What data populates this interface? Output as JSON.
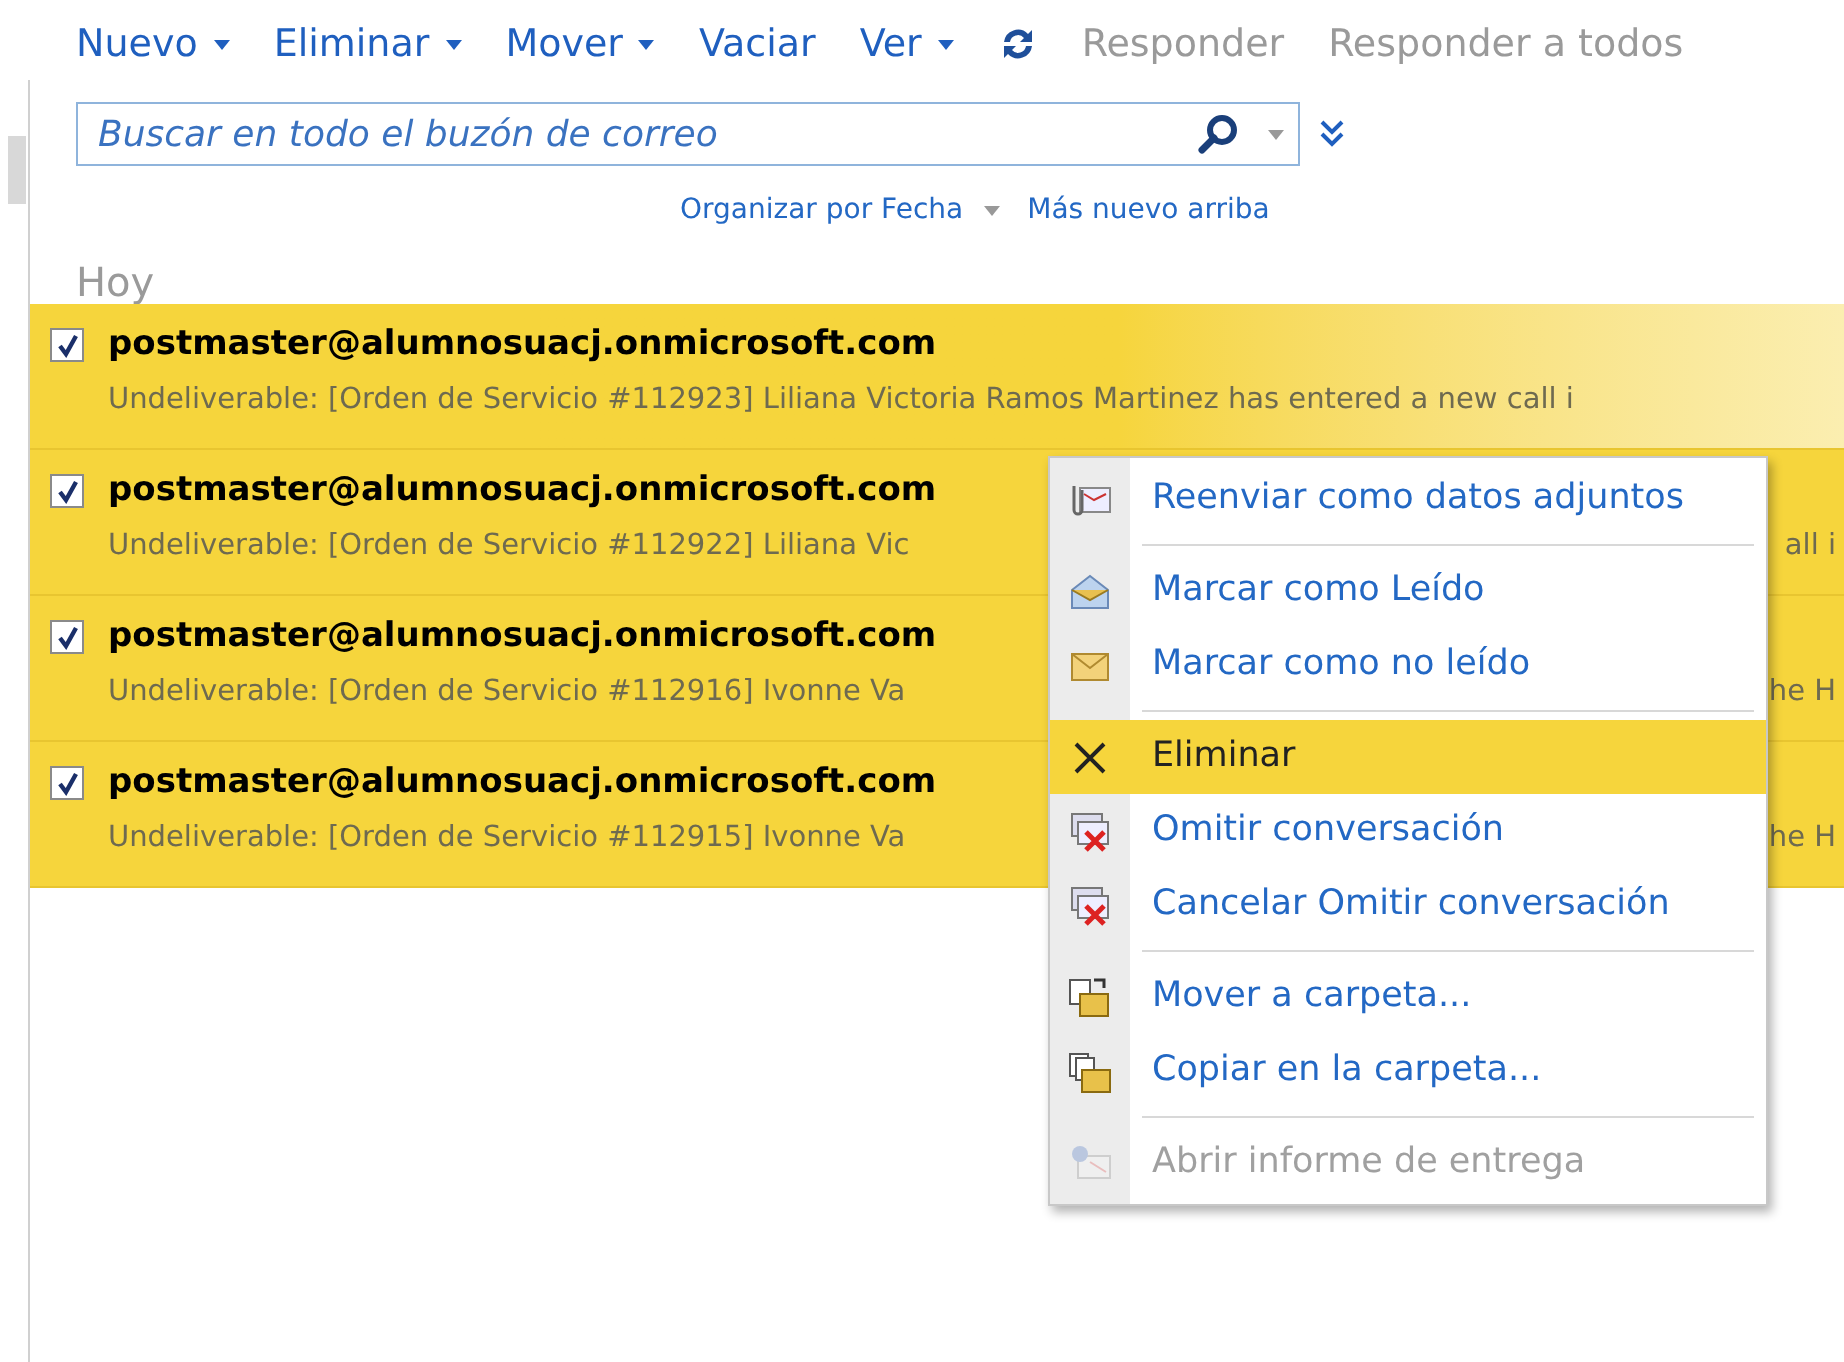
{
  "toolbar": [
    {
      "label": "Nuevo",
      "kind": "dropdown",
      "disabled": false
    },
    {
      "label": "Eliminar",
      "kind": "dropdown",
      "disabled": false
    },
    {
      "label": "Mover",
      "kind": "dropdown",
      "disabled": false
    },
    {
      "label": "Vaciar",
      "kind": "plain",
      "disabled": false
    },
    {
      "label": "Ver",
      "kind": "dropdown",
      "disabled": false
    },
    {
      "kind": "refresh"
    },
    {
      "label": "Responder",
      "kind": "plain",
      "disabled": true
    },
    {
      "label": "Responder a todos",
      "kind": "plain",
      "disabled": true
    }
  ],
  "search": {
    "placeholder": "Buscar en todo el buzón de correo"
  },
  "sort": {
    "by": "Organizar por Fecha",
    "order": "Más nuevo arriba"
  },
  "group": "Hoy",
  "messages": [
    {
      "sender": "postmaster@alumnosuacj.onmicrosoft.com",
      "preview": "Undeliverable: [Orden de Servicio #112923] Liliana Victoria Ramos Martinez has entered a new call i",
      "checked": true,
      "selected": true
    },
    {
      "sender": "postmaster@alumnosuacj.onmicrosoft.com",
      "preview": "Undeliverable: [Orden de Servicio #112922] Liliana Vic",
      "preview_tail": "all i",
      "checked": true,
      "selected": false
    },
    {
      "sender": "postmaster@alumnosuacj.onmicrosoft.com",
      "preview": "Undeliverable: [Orden de Servicio #112916] Ivonne Va",
      "preview_tail": "he H",
      "checked": true,
      "selected": false
    },
    {
      "sender": "postmaster@alumnosuacj.onmicrosoft.com",
      "preview": "Undeliverable: [Orden de Servicio #112915] Ivonne Va",
      "preview_tail": "he H",
      "checked": true,
      "selected": false
    }
  ],
  "context_menu": [
    {
      "kind": "item",
      "label": "Reenviar como datos adjuntos",
      "selected": false,
      "disabled": false
    },
    {
      "kind": "separator"
    },
    {
      "kind": "item",
      "label": "Marcar como Leído",
      "selected": false,
      "disabled": false
    },
    {
      "kind": "item",
      "label": "Marcar como no leído",
      "selected": false,
      "disabled": false
    },
    {
      "kind": "separator"
    },
    {
      "kind": "item",
      "label": "Eliminar",
      "selected": true,
      "disabled": false
    },
    {
      "kind": "item",
      "label": "Omitir conversación",
      "selected": false,
      "disabled": false
    },
    {
      "kind": "item",
      "label": "Cancelar Omitir conversación",
      "selected": false,
      "disabled": false
    },
    {
      "kind": "separator"
    },
    {
      "kind": "item",
      "label": "Mover a carpeta...",
      "selected": false,
      "disabled": false
    },
    {
      "kind": "item",
      "label": "Copiar en la carpeta...",
      "selected": false,
      "disabled": false
    },
    {
      "kind": "separator"
    },
    {
      "kind": "item",
      "label": "Abrir informe de entrega",
      "selected": false,
      "disabled": true
    }
  ]
}
